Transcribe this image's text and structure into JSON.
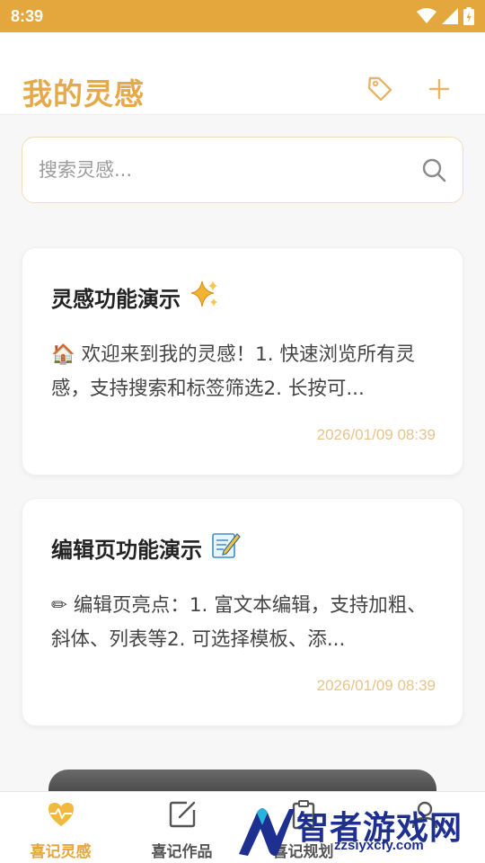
{
  "status_bar": {
    "time": "8:39"
  },
  "header": {
    "title": "我的灵感"
  },
  "search": {
    "placeholder": "搜索灵感..."
  },
  "cards": [
    {
      "title": "灵感功能演示",
      "emoji": "sparkles-icon",
      "body": "🏠 欢迎来到我的灵感！1. 快速浏览所有灵感，支持搜索和标签筛选2. 长按可...",
      "date": "2026/01/09 08:39"
    },
    {
      "title": "编辑页功能演示",
      "emoji": "memo-icon",
      "body": "✏ 编辑页亮点：1. 富文本编辑，支持加粗、斜体、列表等2. 可选择模板、添...",
      "date": "2026/01/09 08:39"
    }
  ],
  "nav": [
    {
      "label": "喜记灵感",
      "icon": "heart-pulse-icon",
      "active": true
    },
    {
      "label": "喜记作品",
      "icon": "edit-square-icon",
      "active": false
    },
    {
      "label": "喜记规划",
      "icon": "clipboard-icon",
      "active": false
    },
    {
      "label": "",
      "icon": "user-icon",
      "active": false
    }
  ],
  "watermark": {
    "text": "智者游戏网",
    "url": "zzsiyxcfy.com"
  },
  "colors": {
    "accent": "#e3a73d",
    "title": "#e6a94a",
    "date": "#e7c48b"
  }
}
